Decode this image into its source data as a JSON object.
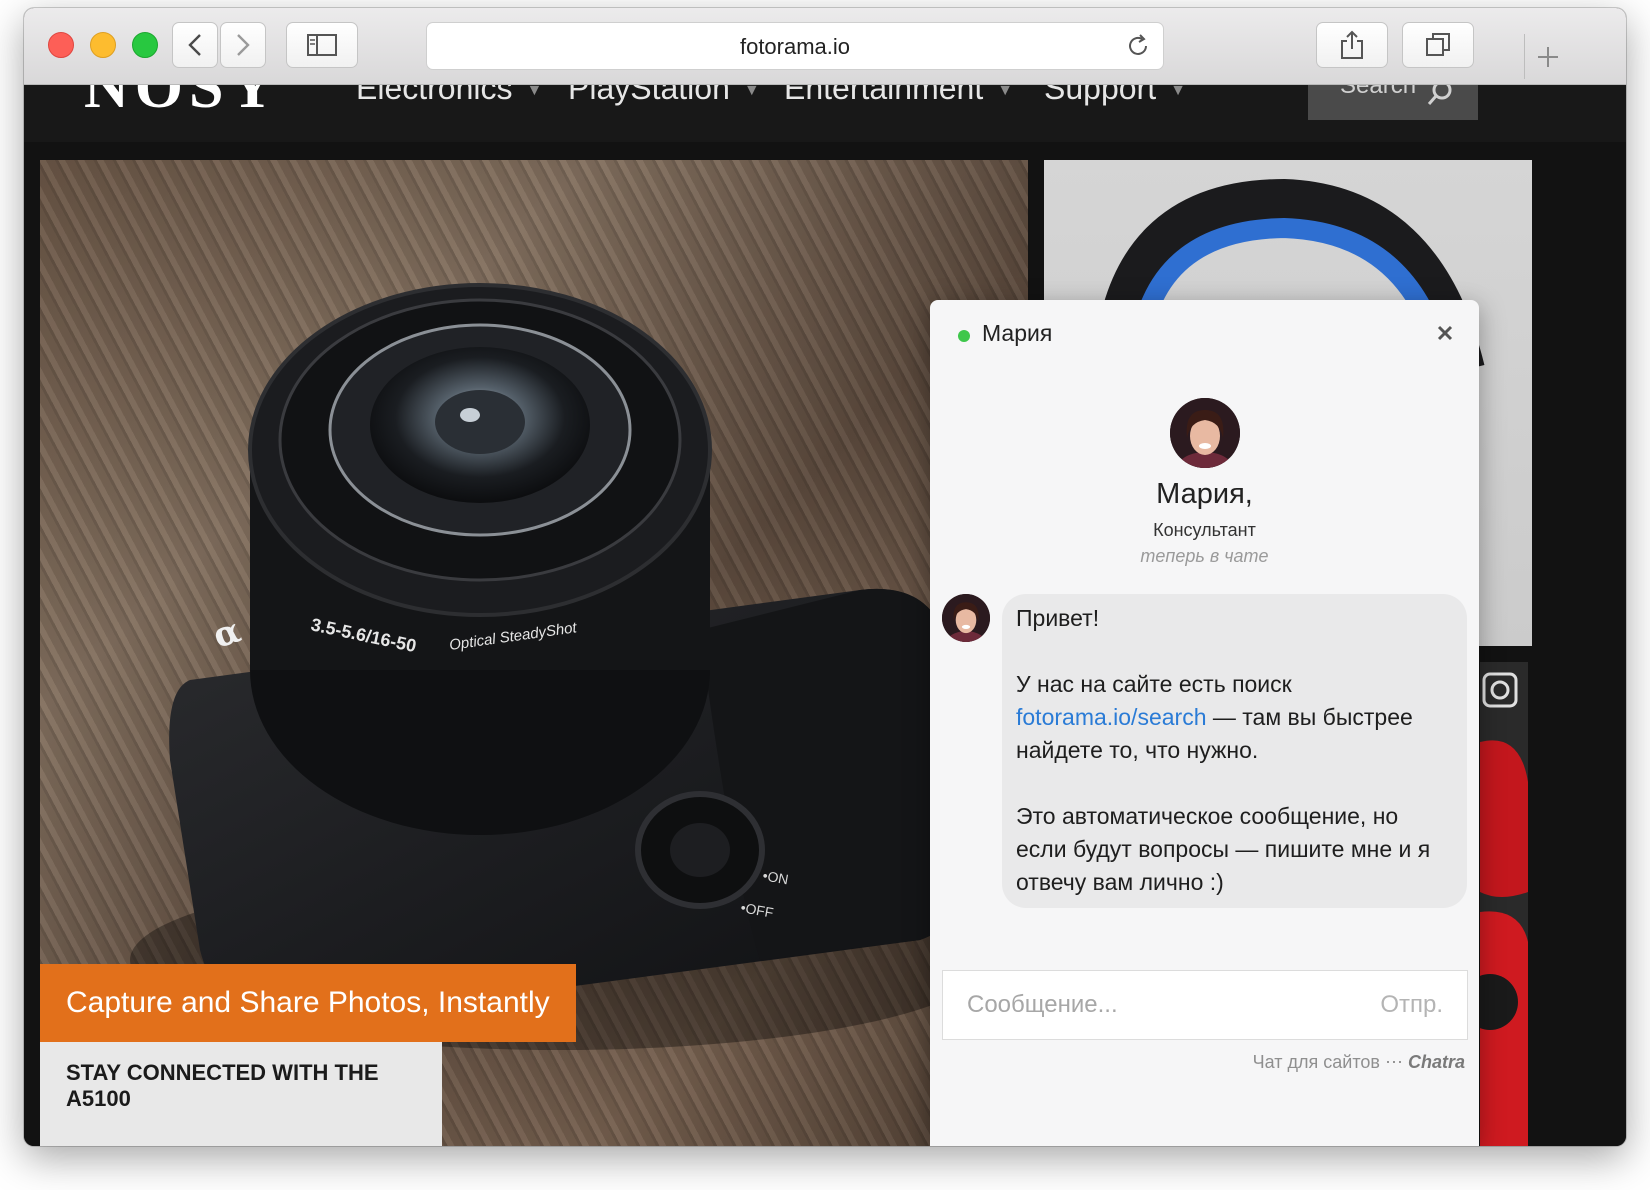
{
  "browser": {
    "url": "fotorama.io"
  },
  "site": {
    "logo": "NOSY",
    "nav": [
      {
        "label": "Electronics"
      },
      {
        "label": "PlayStation"
      },
      {
        "label": "Entertainment"
      },
      {
        "label": "Support"
      }
    ],
    "search_label": "Search"
  },
  "hero": {
    "caption": "Capture and Share Photos, Instantly",
    "subcaption": "STAY CONNECTED WITH THE A5100",
    "camera_labels": {
      "zoom_marking": "3.5-5.6/16-50",
      "stabilizer": "Optical SteadyShot",
      "on": "•ON",
      "off": "•OFF"
    }
  },
  "chat": {
    "header_name": "Мария",
    "agent_name": "Мария,",
    "agent_role": "Консультант",
    "agent_status": "теперь в чате",
    "message": {
      "greeting": "Привет!",
      "line1_before": "У нас на сайте есть поиск",
      "link": "fotorama.io/search",
      "line1_after": " — там вы быстрее найдете то, что нужно.",
      "line2": "Это автоматическое сообщение, но если будут вопросы — пишите мне и я отвечу вам лично :)"
    },
    "input_placeholder": "Сообщение...",
    "send_label": "Отпр.",
    "footer_text": "Чат для сайтов",
    "footer_brand": "Chatra"
  }
}
